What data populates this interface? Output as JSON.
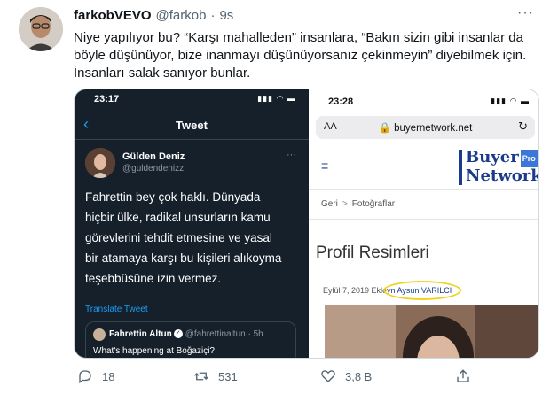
{
  "tweet": {
    "display_name": "farkobVEVO",
    "handle": "@farkob",
    "separator": "·",
    "time": "9s",
    "more": "···",
    "lines": [
      "Niye yapılıyor bu? “Karşı mahalleden” insanlara, “Bakın sizin gibi insanlar da",
      "böyle düşünüyor, bize inanmayı düşünüyorsanız çekinmeyin” diyebilmek için.",
      "İnsanları salak sanıyor bunlar."
    ]
  },
  "left_screenshot": {
    "status_time": "23:17",
    "status_icons": "▮▮▮ ◠ ▬",
    "back": "‹",
    "title": "Tweet",
    "user_name": "Gülden Deniz",
    "user_handle": "@guldendenizz",
    "more": "···",
    "body_lines": [
      "Fahrettin bey çok haklı. Dünyada",
      "hiçbir ülke, radikal unsurların kamu",
      "görevlerini tehdit etmesine ve yasal",
      "bir atamaya karşı bu kişileri alıkoyma",
      "teşebbüsüne izin vermez."
    ],
    "translate": "Translate Tweet",
    "quote_name": "Fahrettin Altun",
    "quote_handle": "@fahrettinaltun · 5h",
    "quote_text": "What's happening at Boğaziçi?"
  },
  "right_screenshot": {
    "status_time": "23:28",
    "status_icons": "▮▮▮ ◠ ▬",
    "aa": "AA",
    "url": "🔒 buyernetwork.net",
    "reload": "↻",
    "menu": "≡",
    "logo_line1": "Buyer",
    "logo_pro": "Pro",
    "logo_line2": "Network",
    "crumb_home": "Geri",
    "crumb_sep": ">",
    "crumb_page": "Fotoğraflar",
    "heading": "Profil Resimleri",
    "meta_date": "Eylül 7, 2019 Ekley",
    "meta_name": "n Aysun VARILCI"
  },
  "actions": {
    "reply_count": "18",
    "retweet_count": "531",
    "like_count": "3,8 B"
  },
  "colors": {
    "accent": "#1d9bf0",
    "dark_bg": "#15202b",
    "brand": "#1b3b8a",
    "highlight": "#f1d21b"
  }
}
